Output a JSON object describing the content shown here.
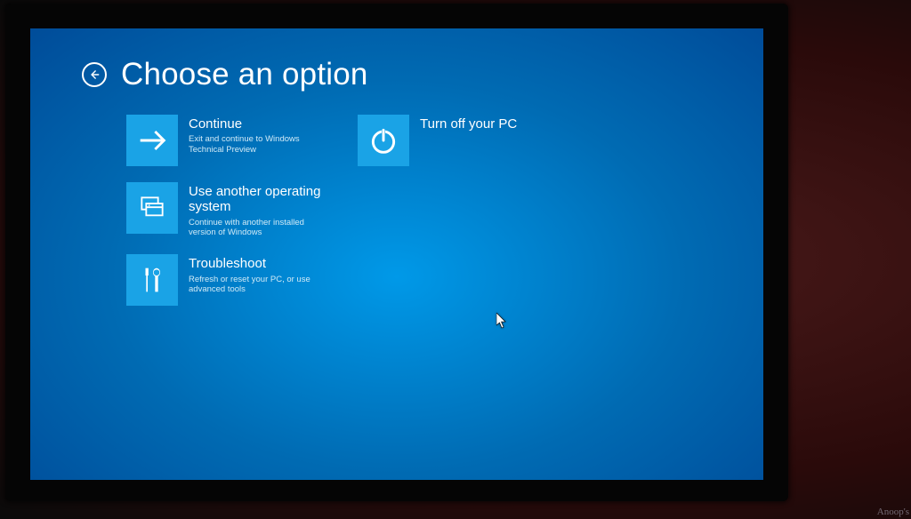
{
  "header": {
    "title": "Choose an option"
  },
  "options": {
    "continue": {
      "title": "Continue",
      "desc": "Exit and continue to Windows Technical Preview"
    },
    "turn_off": {
      "title": "Turn off your PC",
      "desc": ""
    },
    "use_another": {
      "title": "Use another operating system",
      "desc": "Continue with another installed version of Windows"
    },
    "troubleshoot": {
      "title": "Troubleshoot",
      "desc": "Refresh or reset your PC, or use advanced tools"
    }
  },
  "watermark": "Anoop's"
}
